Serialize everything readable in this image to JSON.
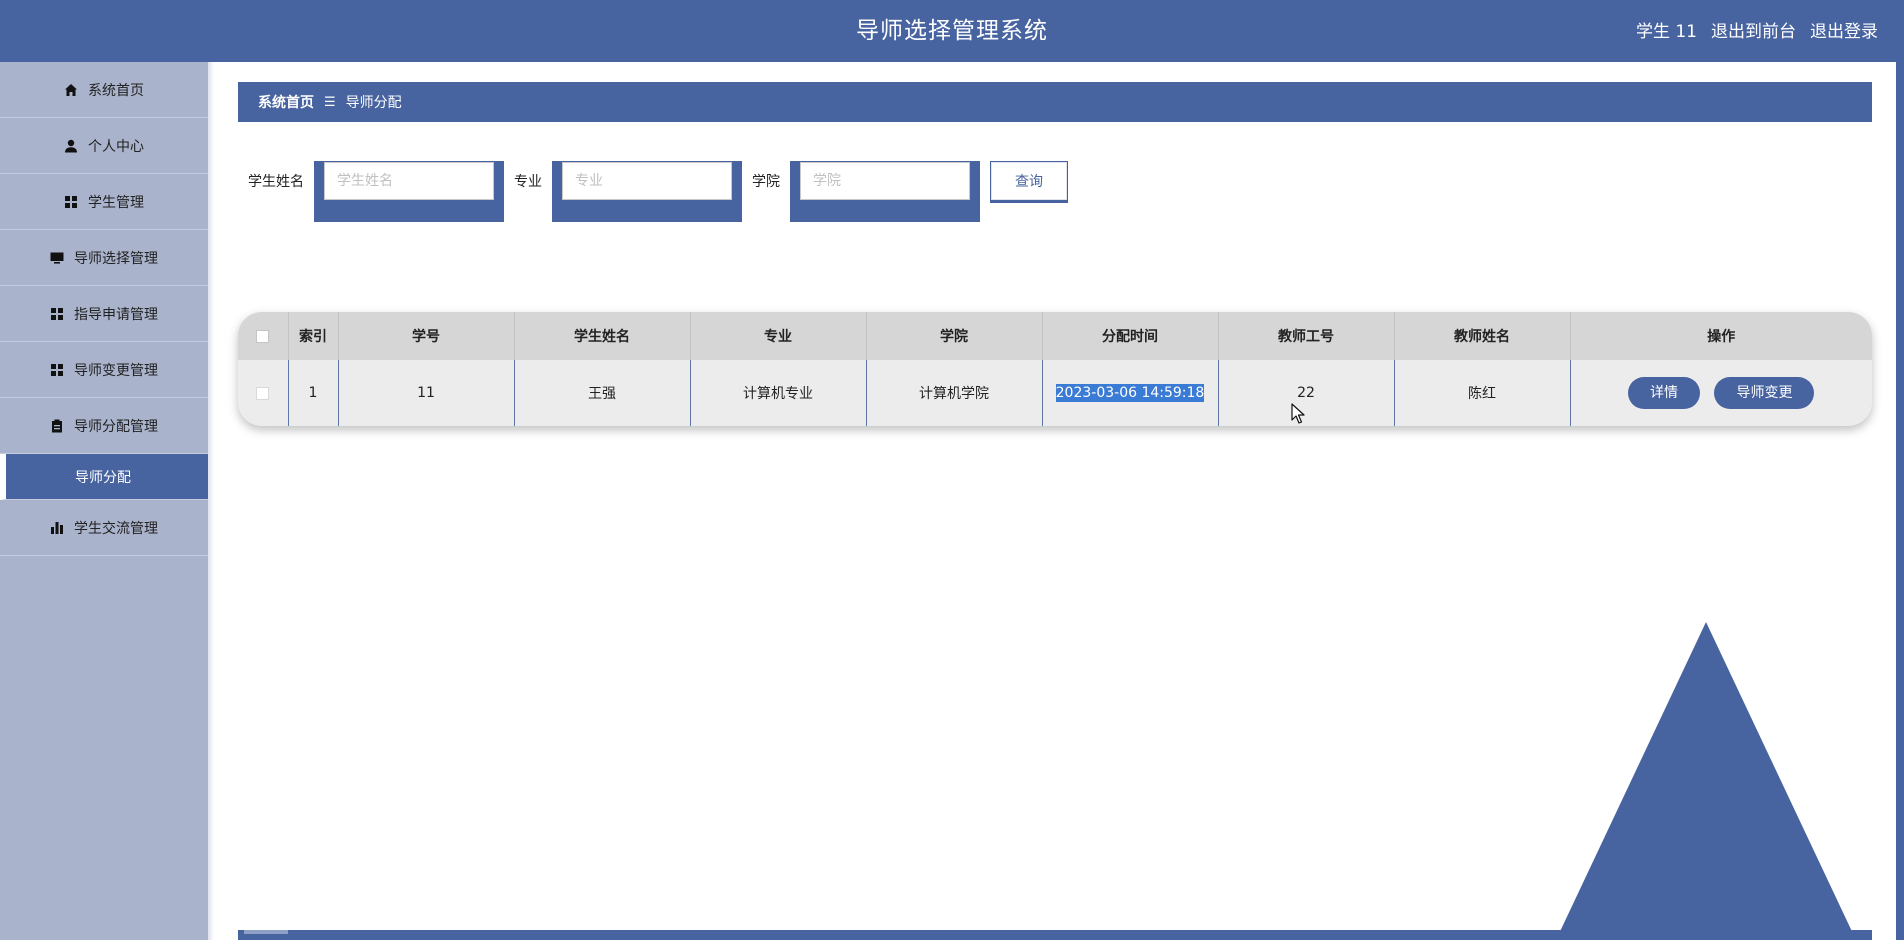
{
  "header": {
    "title": "导师选择管理系统",
    "user": "学生 11",
    "to_front": "退出到前台",
    "logout": "退出登录"
  },
  "sidebar": {
    "items": [
      {
        "label": "系统首页",
        "icon": "home-icon"
      },
      {
        "label": "个人中心",
        "icon": "user-icon"
      },
      {
        "label": "学生管理",
        "icon": "grid-icon"
      },
      {
        "label": "导师选择管理",
        "icon": "monitor-icon"
      },
      {
        "label": "指导申请管理",
        "icon": "grid-icon"
      },
      {
        "label": "导师变更管理",
        "icon": "grid-icon"
      },
      {
        "label": "导师分配管理",
        "icon": "clipboard-icon"
      },
      {
        "label": "导师分配",
        "icon": "",
        "active": true
      },
      {
        "label": "学生交流管理",
        "icon": "bar-chart-icon"
      }
    ]
  },
  "breadcrumb": {
    "home": "系统首页",
    "separator": "☰",
    "current": "导师分配"
  },
  "search": {
    "student_name_label": "学生姓名",
    "student_name_placeholder": "学生姓名",
    "major_label": "专业",
    "major_placeholder": "专业",
    "college_label": "学院",
    "college_placeholder": "学院",
    "query_button": "查询"
  },
  "table": {
    "headers": [
      "索引",
      "学号",
      "学生姓名",
      "专业",
      "学院",
      "分配时间",
      "教师工号",
      "教师姓名",
      "操作"
    ],
    "rows": [
      {
        "index": "1",
        "student_id": "11",
        "student_name": "王强",
        "major": "计算机专业",
        "college": "计算机学院",
        "assign_time": "2023-03-06 14:59:18",
        "teacher_id": "22",
        "teacher_name": "陈红",
        "detail_button": "详情",
        "change_button": "导师变更"
      }
    ]
  },
  "colors": {
    "primary": "#4763a0",
    "sidebar_bg": "#aab3cc",
    "selection": "#3a7bd5"
  }
}
